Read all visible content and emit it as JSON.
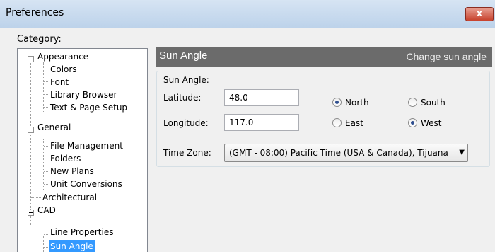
{
  "window": {
    "title": "Preferences",
    "close_symbol": "x"
  },
  "category_label": "Category:",
  "tree": {
    "appearance": "Appearance",
    "colors": "Colors",
    "font": "Font",
    "library_browser": "Library Browser",
    "text_page_setup": "Text & Page Setup",
    "general": "General",
    "file_management": "File Management",
    "folders": "Folders",
    "new_plans": "New Plans",
    "unit_conversions": "Unit Conversions",
    "architectural": "Architectural",
    "cad": "CAD",
    "line_properties": "Line Properties",
    "sun_angle": "Sun Angle"
  },
  "panel": {
    "title": "Sun Angle",
    "description": "Change sun angle",
    "group_label": "Sun Angle:",
    "latitude_label": "Latitude:",
    "latitude_value": "48.0",
    "longitude_label": "Longitude:",
    "longitude_value": "117.0",
    "north_label": "North",
    "south_label": "South",
    "east_label": "East",
    "west_label": "West",
    "timezone_label": "Time Zone:",
    "timezone_value": "(GMT - 08:00) Pacific Time (USA & Canada), Tijuana"
  }
}
